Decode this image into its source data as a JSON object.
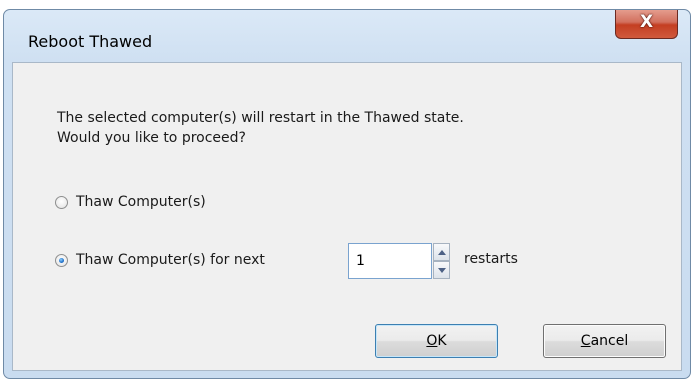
{
  "dialog": {
    "title": "Reboot Thawed",
    "close_glyph": "X",
    "message_line1": "The selected computer(s) will restart in the Thawed state.",
    "message_line2": "Would you like to proceed?"
  },
  "options": {
    "thaw": {
      "label": "Thaw Computer(s)",
      "checked": false
    },
    "thaw_next": {
      "label": "Thaw Computer(s) for next",
      "checked": true
    },
    "restarts_value": "1",
    "restarts_suffix": "restarts"
  },
  "buttons": {
    "ok": {
      "mnemonic": "O",
      "rest": "K"
    },
    "cancel": {
      "mnemonic": "C",
      "rest": "ancel"
    }
  },
  "icons": {
    "close": "close-icon",
    "spin_up": "up-arrow-icon",
    "spin_down": "down-arrow-icon"
  },
  "colors": {
    "close_button": "#c43e22",
    "selected_radio": "#1e6fc8",
    "default_button_border": "#3c7fb1",
    "dialog_frame": "#cfe0f2"
  }
}
